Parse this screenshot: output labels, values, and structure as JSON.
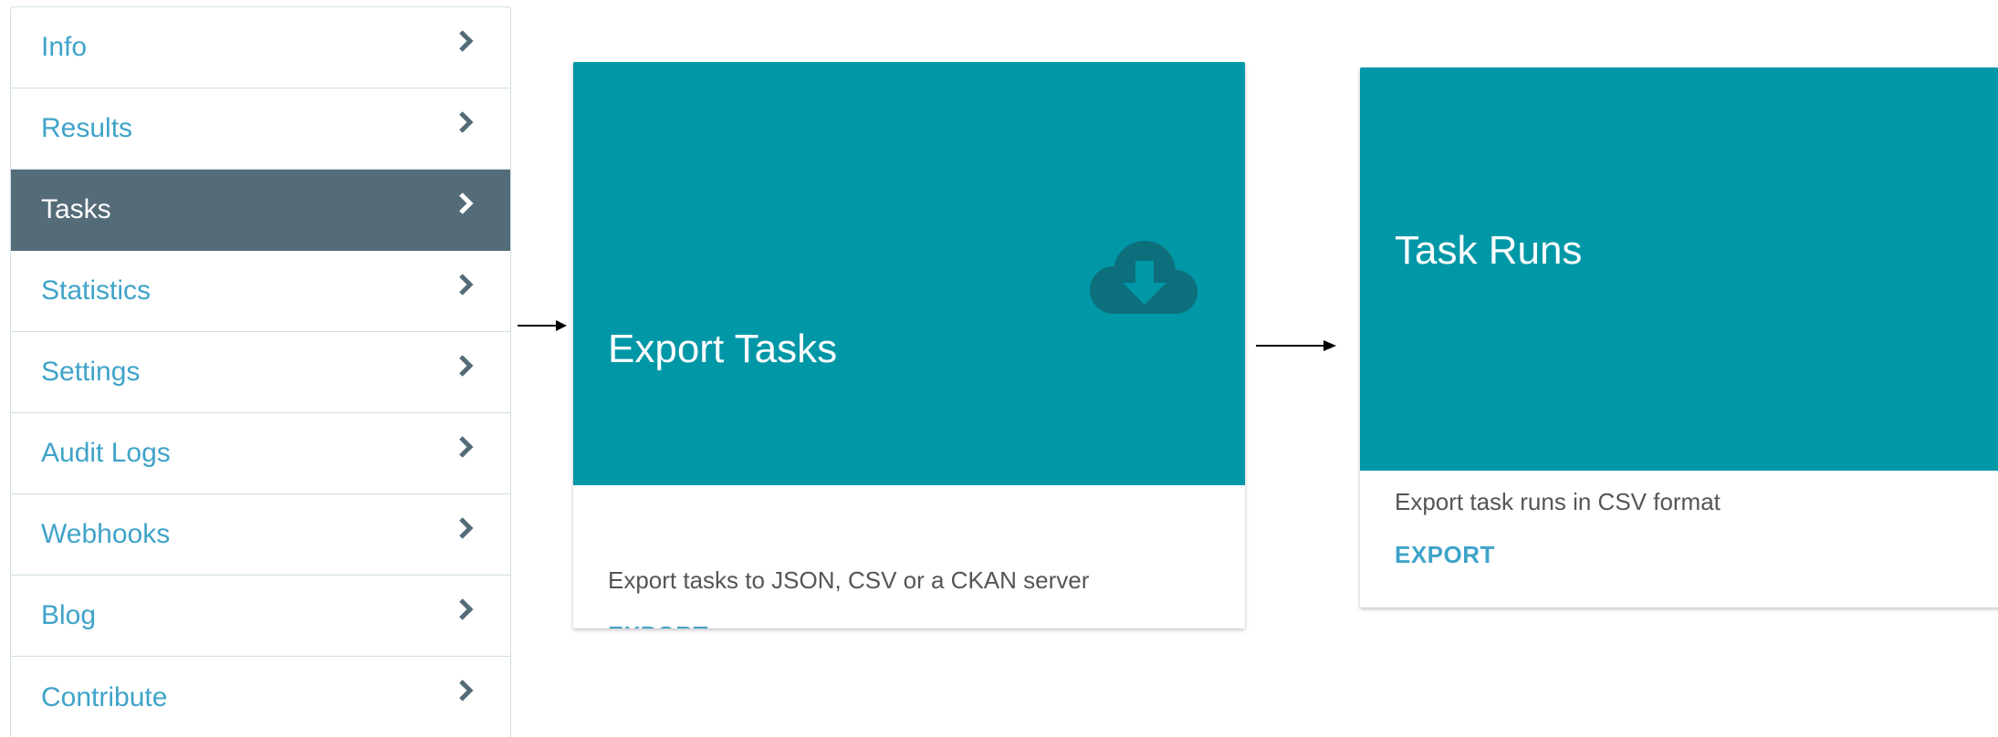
{
  "sidebar": {
    "items": [
      {
        "label": "Info",
        "active": false
      },
      {
        "label": "Results",
        "active": false
      },
      {
        "label": "Tasks",
        "active": true
      },
      {
        "label": "Statistics",
        "active": false
      },
      {
        "label": "Settings",
        "active": false
      },
      {
        "label": "Audit Logs",
        "active": false
      },
      {
        "label": "Webhooks",
        "active": false
      },
      {
        "label": "Blog",
        "active": false
      },
      {
        "label": "Contribute",
        "active": false
      }
    ]
  },
  "cards": {
    "export_tasks": {
      "title": "Export Tasks",
      "description": "Export tasks to JSON, CSV or a CKAN server",
      "action": "EXPORT",
      "icon": "cloud-download-icon"
    },
    "task_runs": {
      "title": "Task Runs",
      "description": "Export task runs in CSV format",
      "action": "EXPORT"
    }
  },
  "colors": {
    "accent": "#0097a7",
    "link": "#3fa3c9",
    "sidebar_active_bg": "#546b78",
    "cloud_icon": "#0d6f7b"
  }
}
